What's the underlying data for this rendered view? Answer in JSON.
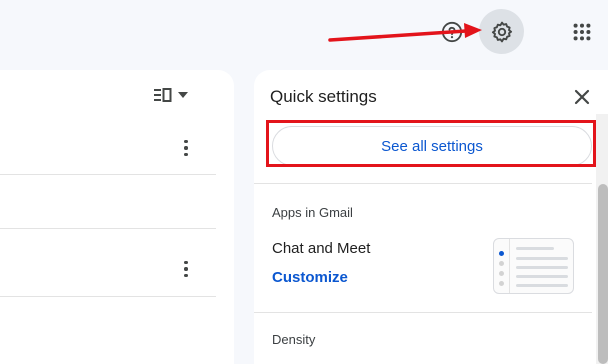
{
  "header": {
    "help_icon": "help-circle-icon",
    "settings_icon": "gear-icon",
    "apps_icon": "apps-grid-icon"
  },
  "mail_list": {
    "view_toggle_icon": "split-pane-toggle-icon",
    "row_menu_icon": "more-vert-icon"
  },
  "quick_settings": {
    "title": "Quick settings",
    "close_icon": "close-icon",
    "see_all_label": "See all settings",
    "apps_section_label": "Apps in Gmail",
    "chat_label": "Chat and Meet",
    "customize_label": "Customize",
    "density_label": "Density"
  },
  "colors": {
    "background": "#f6f8fc",
    "panel": "#ffffff",
    "accent": "#0b57d0",
    "annotation": "#e3141b",
    "gear_highlight": "#dde1e6"
  }
}
